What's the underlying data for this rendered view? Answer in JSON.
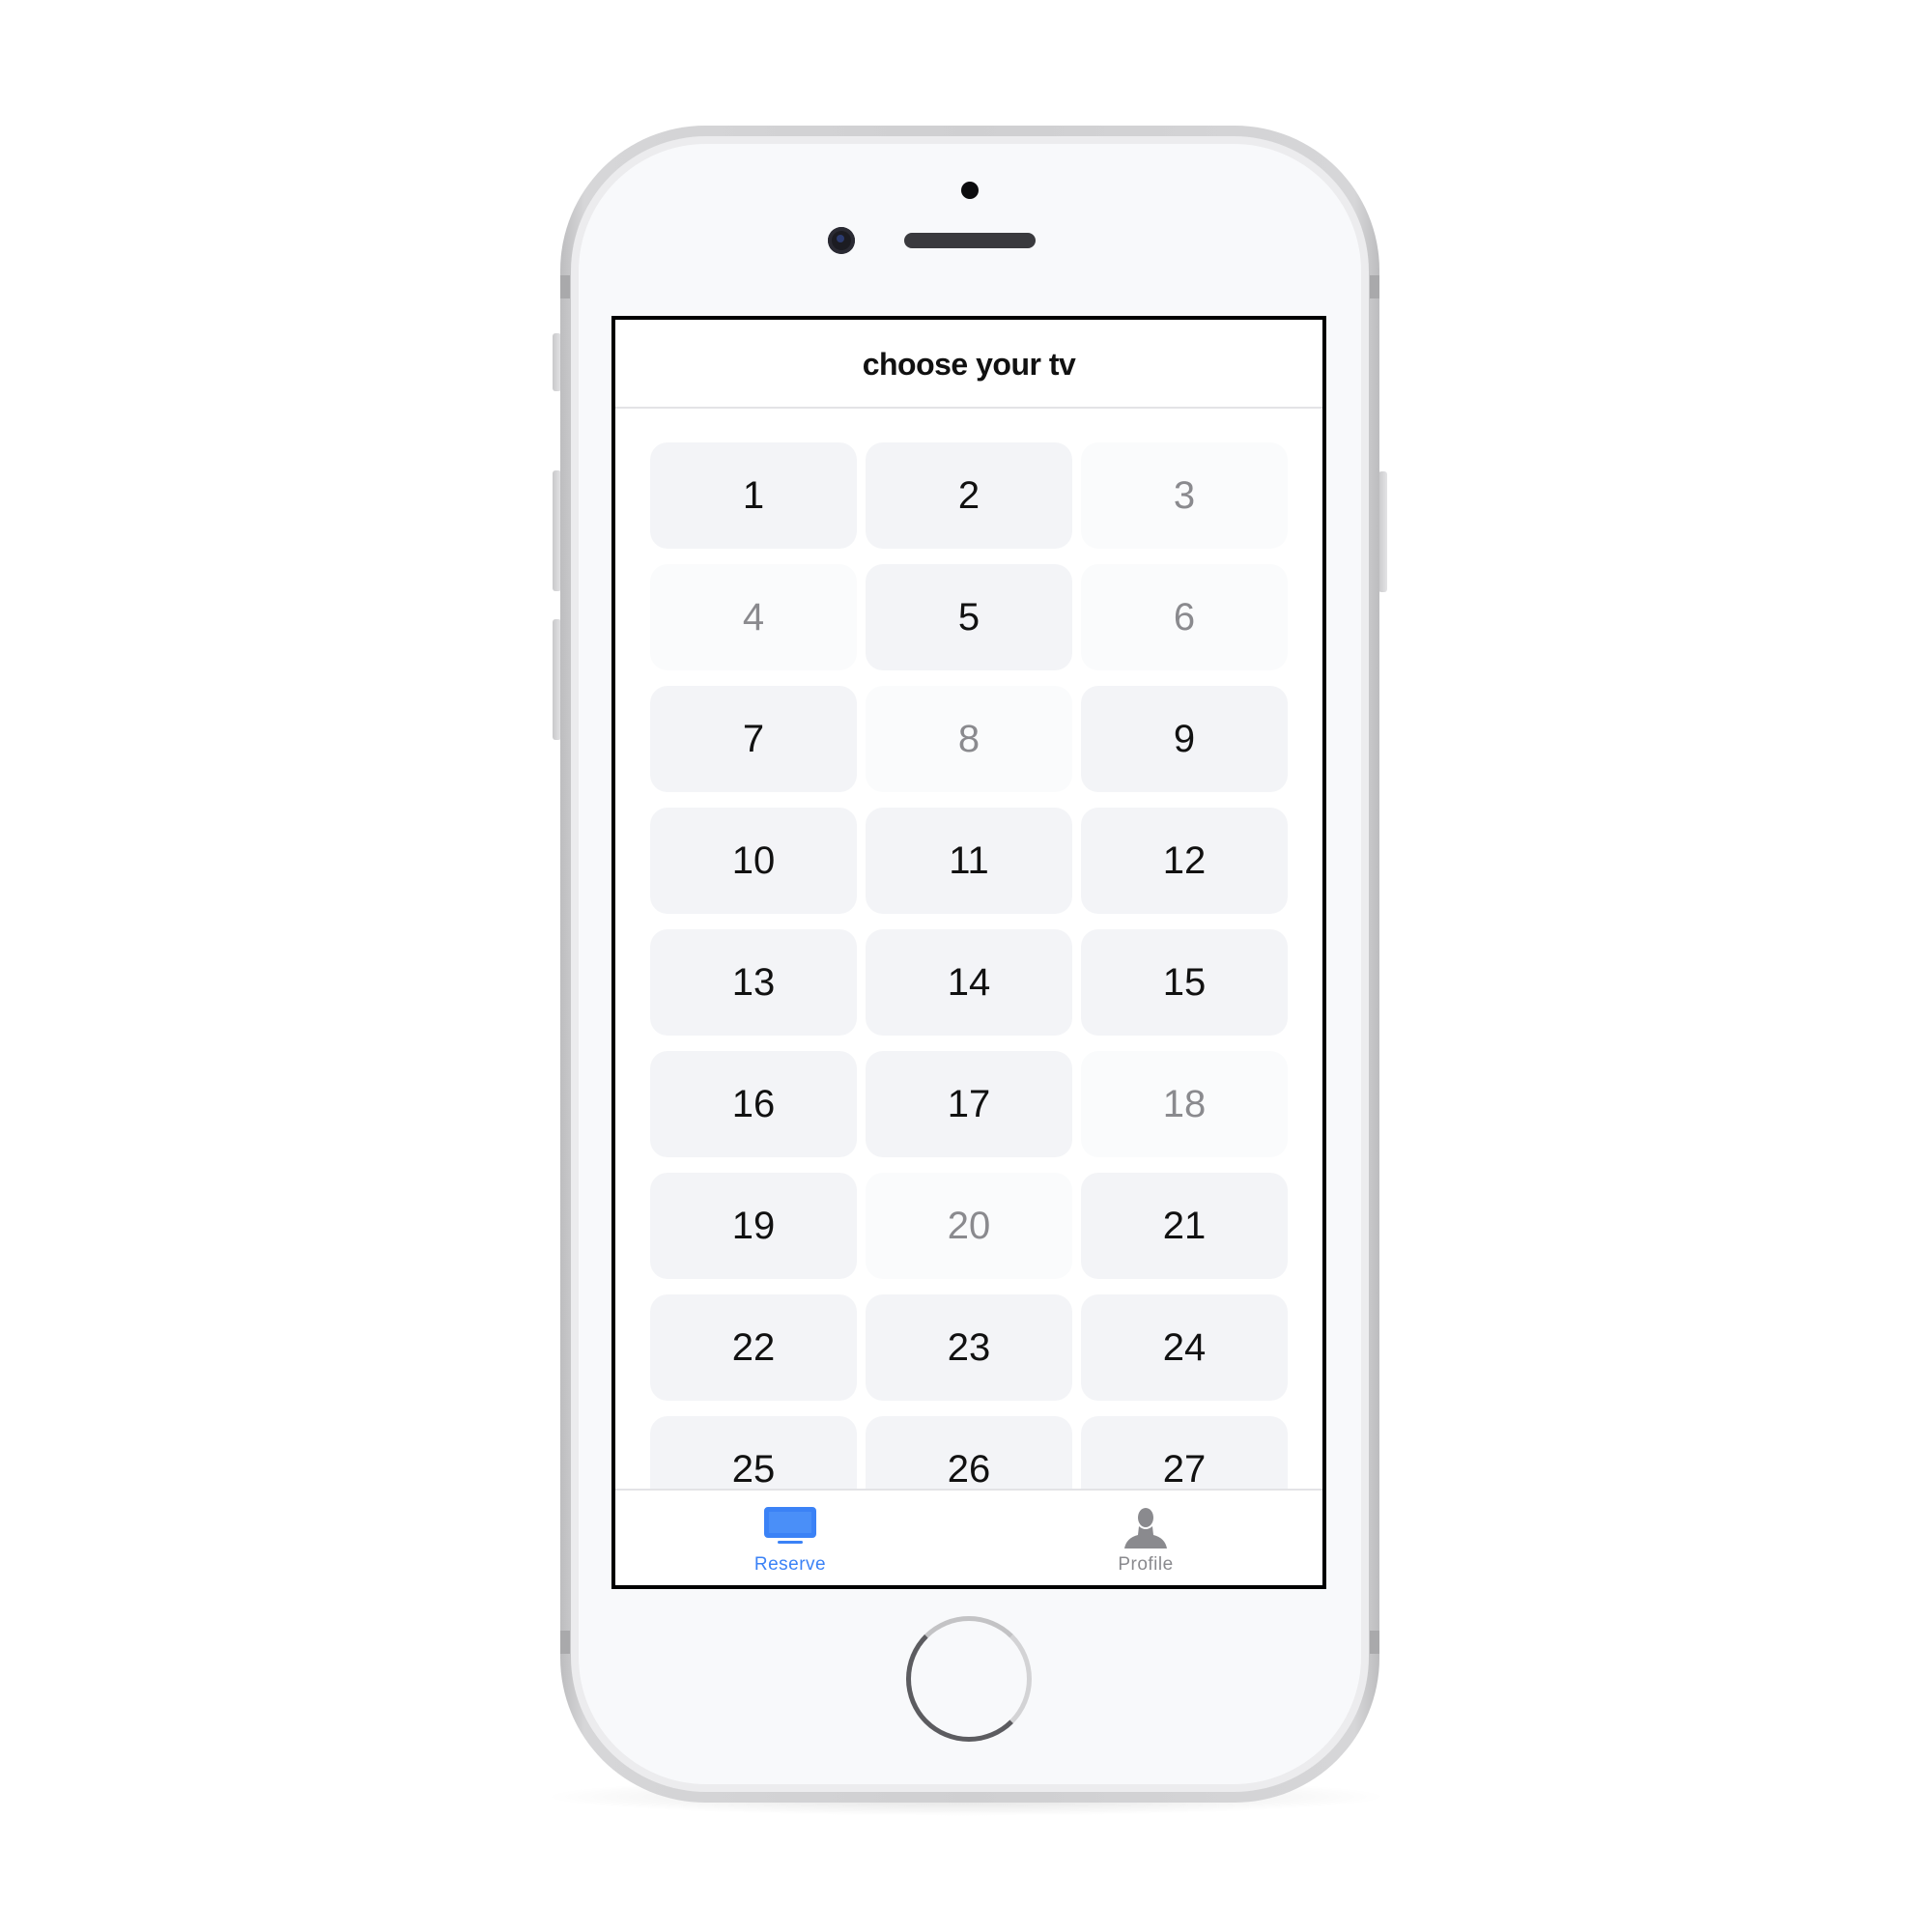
{
  "screen": {
    "title": "choose your tv"
  },
  "tvs": [
    {
      "label": "1",
      "available": true
    },
    {
      "label": "2",
      "available": true
    },
    {
      "label": "3",
      "available": false
    },
    {
      "label": "4",
      "available": false
    },
    {
      "label": "5",
      "available": true
    },
    {
      "label": "6",
      "available": false
    },
    {
      "label": "7",
      "available": true
    },
    {
      "label": "8",
      "available": false
    },
    {
      "label": "9",
      "available": true
    },
    {
      "label": "10",
      "available": true
    },
    {
      "label": "11",
      "available": true
    },
    {
      "label": "12",
      "available": true
    },
    {
      "label": "13",
      "available": true
    },
    {
      "label": "14",
      "available": true
    },
    {
      "label": "15",
      "available": true
    },
    {
      "label": "16",
      "available": true
    },
    {
      "label": "17",
      "available": true
    },
    {
      "label": "18",
      "available": false
    },
    {
      "label": "19",
      "available": true
    },
    {
      "label": "20",
      "available": false
    },
    {
      "label": "21",
      "available": true
    },
    {
      "label": "22",
      "available": true
    },
    {
      "label": "23",
      "available": true
    },
    {
      "label": "24",
      "available": true
    },
    {
      "label": "25",
      "available": true
    },
    {
      "label": "26",
      "available": true
    },
    {
      "label": "27",
      "available": true
    }
  ],
  "tab_bar": {
    "tabs": [
      {
        "label": "Reserve",
        "icon": "tv-icon",
        "active": true
      },
      {
        "label": "Profile",
        "icon": "person-icon",
        "active": false
      }
    ]
  },
  "colors": {
    "accent": "#3b82f6",
    "tab_inactive": "#8a8a8e",
    "cell_available_bg": "#f3f4f7",
    "cell_unavailable_bg": "#fafbfc",
    "cell_unavailable_text": "#8a8a8e"
  }
}
